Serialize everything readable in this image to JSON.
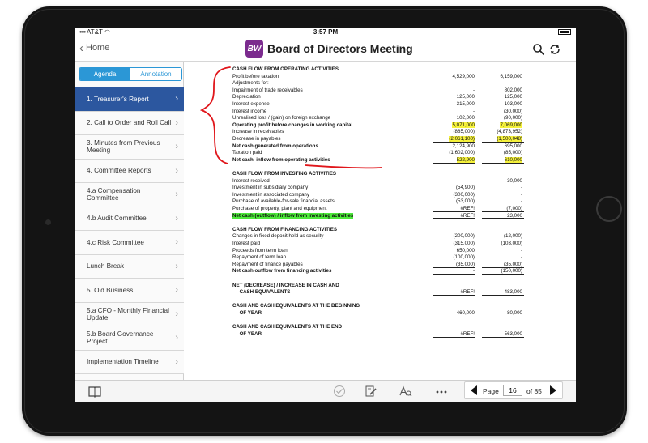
{
  "status_bar": {
    "carrier": "AT&T",
    "time": "3:57 PM",
    "battery": ""
  },
  "nav": {
    "back_label": "Home",
    "logo": "BW",
    "title": "Board of Directors Meeting"
  },
  "sidebar": {
    "tabs": [
      {
        "label": "Agenda",
        "active": true
      },
      {
        "label": "Annotation",
        "active": false
      }
    ],
    "items": [
      {
        "label": "1. Treasurer's Report",
        "selected": true
      },
      {
        "label": "2. Call to Order and Roll Call"
      },
      {
        "label": "3. Minutes from Previous Meeting"
      },
      {
        "label": "4. Committee Reports"
      },
      {
        "label": "4.a Compensation Committee"
      },
      {
        "label": "4.b Audit Committee"
      },
      {
        "label": "4.c Risk Committee"
      },
      {
        "label": "Lunch Break"
      },
      {
        "label": "5. Old Business"
      },
      {
        "label": "5.a CFO - Monthly Financial Update"
      },
      {
        "label": "5.b Board Governance Project"
      },
      {
        "label": "Implementation Timeline"
      }
    ]
  },
  "document": {
    "rows": [
      {
        "label": "CASH FLOW FROM OPERATING ACTIVITIES",
        "v1": "",
        "v2": "",
        "bold": true
      },
      {
        "label": "Profit before taxation",
        "v1": "4,529,000",
        "v2": "6,159,000"
      },
      {
        "label": "Adjustments for:",
        "v1": "",
        "v2": ""
      },
      {
        "label": "Impairment of trade receivables",
        "v1": "-",
        "v2": "802,000"
      },
      {
        "label": "Depreciation",
        "v1": "125,000",
        "v2": "125,000"
      },
      {
        "label": "Interest expense",
        "v1": "315,000",
        "v2": "103,000"
      },
      {
        "label": "Interest income",
        "v1": "-",
        "v2": "(30,000)"
      },
      {
        "label": "Unrealised loss / (gain) on foreign exchange",
        "v1": "102,000",
        "v2": "(90,000)"
      },
      {
        "label": "Operating profit before changes in working capital",
        "v1": "5,071,000",
        "v2": "7,069,000",
        "bold": true,
        "hl1": true,
        "hl2": true
      },
      {
        "label": "Increase in receivables",
        "v1": "(885,000)",
        "v2": "(4,873,952)"
      },
      {
        "label": "Decrease in payables",
        "v1": "(2,061,100)",
        "v2": "(1,500,048)",
        "hl1": true,
        "hl2": true
      },
      {
        "label": "Net cash generated from operations",
        "v1": "2,124,900",
        "v2": "695,000",
        "bold": true
      },
      {
        "label": "Taxation paid",
        "v1": "(1,602,000)",
        "v2": "(85,000)"
      },
      {
        "label": "Net cash  inflow from operating activities",
        "v1": "522,900",
        "v2": "610,000",
        "bold": true,
        "hl1": true,
        "hl2": true
      },
      {
        "label": "",
        "v1": "",
        "v2": ""
      },
      {
        "label": "CASH FLOW FROM INVESTING ACTIVITIES",
        "v1": "",
        "v2": "",
        "bold": true
      },
      {
        "label": "Interest received",
        "v1": "-",
        "v2": "30,000"
      },
      {
        "label": "Investment in subsidiary company",
        "v1": "(54,900)",
        "v2": "-"
      },
      {
        "label": "Investment in associated company",
        "v1": "(300,000)",
        "v2": "-"
      },
      {
        "label": "Purchase of available-for-sale financial assets",
        "v1": "(53,000)",
        "v2": "-"
      },
      {
        "label": "Purchase of property, plant and equipment",
        "v1": "#REF!",
        "v2": "(7,000)"
      },
      {
        "label": "Net cash (outflow) / inflow from investing activities",
        "v1": "#REF!",
        "v2": "23,000",
        "bold": true,
        "hlg": true
      },
      {
        "label": "",
        "v1": "",
        "v2": ""
      },
      {
        "label": "CASH FLOW FROM FINANCING ACTIVITIES",
        "v1": "",
        "v2": "",
        "bold": true
      },
      {
        "label": "Changes in fixed deposit held as security",
        "v1": "(200,000)",
        "v2": "(12,000)"
      },
      {
        "label": "Interest paid",
        "v1": "(315,000)",
        "v2": "(103,000)"
      },
      {
        "label": "Proceeds from term loan",
        "v1": "650,000",
        "v2": "-"
      },
      {
        "label": "Repayment of term loan",
        "v1": "(100,000)",
        "v2": "-"
      },
      {
        "label": "Repayment of finance payables",
        "v1": "(35,000)",
        "v2": "(35,000)"
      },
      {
        "label": "Net cash outflow from financing activities",
        "v1": "-",
        "v2": "(150,000)",
        "bold": true
      },
      {
        "label": "",
        "v1": "",
        "v2": ""
      },
      {
        "label": "NET (DECREASE) / INCREASE IN CASH AND",
        "v1": "",
        "v2": "",
        "bold": true
      },
      {
        "label": "     CASH EQUIVALENTS",
        "v1": "#REF!",
        "v2": "483,000",
        "bold": true
      },
      {
        "label": "",
        "v1": "",
        "v2": ""
      },
      {
        "label": "CASH AND CASH EQUIVALENTS AT THE BEGINNING",
        "v1": "",
        "v2": "",
        "bold": true
      },
      {
        "label": "     OF YEAR",
        "v1": "460,000",
        "v2": "80,000",
        "bold": true
      },
      {
        "label": "",
        "v1": "",
        "v2": ""
      },
      {
        "label": "CASH AND CASH EQUIVALENTS AT THE END",
        "v1": "",
        "v2": "",
        "bold": true
      },
      {
        "label": "     OF YEAR",
        "v1": "#REF!",
        "v2": "563,000",
        "bold": true
      }
    ]
  },
  "toolbar": {
    "icons": [
      "book-icon",
      "check-icon",
      "pen-icon",
      "text-search-icon",
      "more-icon"
    ]
  },
  "pager": {
    "label": "Page",
    "current": "16",
    "of_label": "of 85"
  },
  "colors": {
    "accent": "#2b97d6",
    "selected": "#2c579f",
    "logo": "#7b2b8e",
    "highlight_yellow": "#f6f23c",
    "highlight_green": "#4dea3a",
    "annotation": "#e0161b"
  }
}
